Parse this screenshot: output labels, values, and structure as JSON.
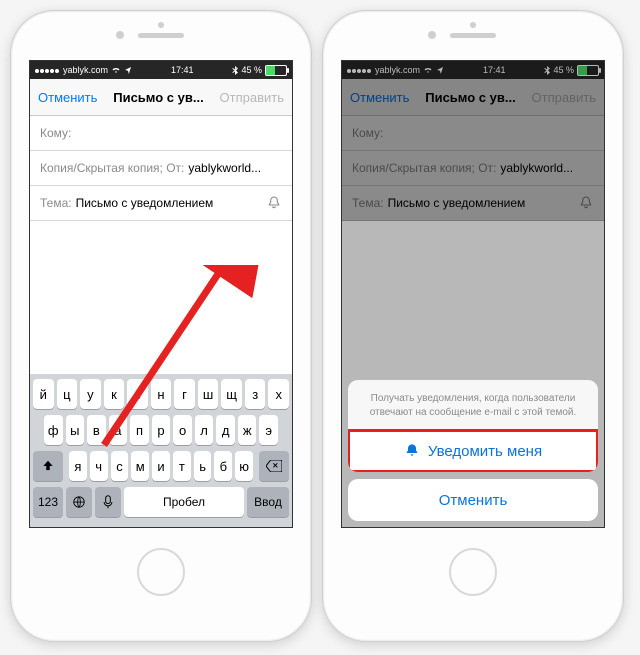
{
  "statusbar": {
    "carrier": "yablyk.com",
    "time": "17:41",
    "battery_pct": "45 %"
  },
  "nav": {
    "cancel": "Отменить",
    "title": "Письмо с ув...",
    "send": "Отправить"
  },
  "fields": {
    "to_label": "Кому:",
    "cc_label": "Копия/Скрытая копия; От:",
    "cc_value": "yablykworld...",
    "subject_label": "Тема:",
    "subject_value": "Письмо с уведомлением"
  },
  "keyboard": {
    "row1": [
      "й",
      "ц",
      "у",
      "к",
      "е",
      "н",
      "г",
      "ш",
      "щ",
      "з",
      "х"
    ],
    "row2": [
      "ф",
      "ы",
      "в",
      "а",
      "п",
      "р",
      "о",
      "л",
      "д",
      "ж",
      "э"
    ],
    "row3_mid": [
      "я",
      "ч",
      "с",
      "м",
      "и",
      "т",
      "ь",
      "б",
      "ю"
    ],
    "num": "123",
    "space": "Пробел",
    "enter": "Ввод"
  },
  "sheet": {
    "message": "Получать уведомления, когда пользователи отвечают на сообщение e-mail с этой темой.",
    "notify": "Уведомить меня",
    "cancel": "Отменить"
  }
}
